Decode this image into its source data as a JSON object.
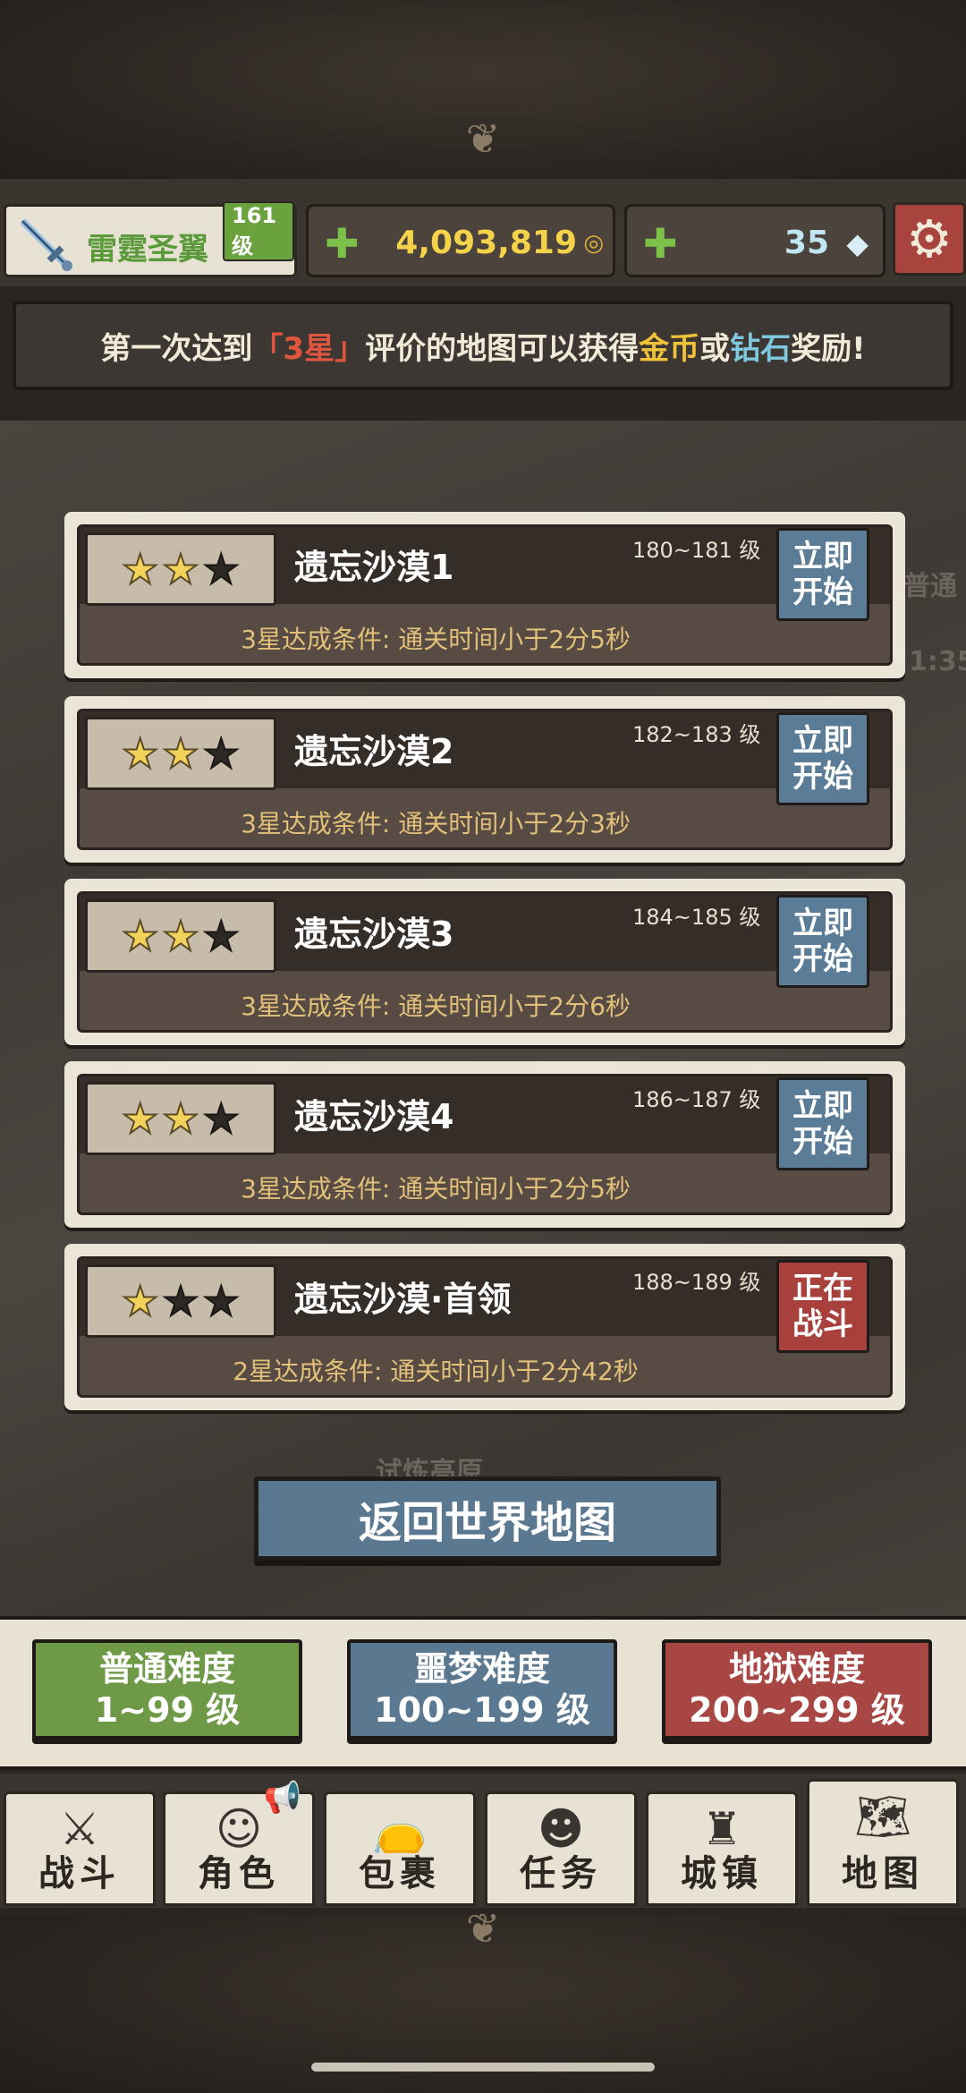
{
  "player": {
    "name": "雷霆圣翼",
    "level": "161 级"
  },
  "resources": {
    "gold": "4,093,819",
    "diamonds": "35"
  },
  "notice": {
    "part1": "第一次达到",
    "highlight_star": "「3星」",
    "part2": "评价的地图可以获得",
    "gold_word": "金币",
    "or_word": "或",
    "diamond_word": "钻石",
    "part3": "奖励!"
  },
  "levels": [
    {
      "name": "遗忘沙漠1",
      "range": "180~181 级",
      "stars": 2,
      "condition": "3星达成条件:  通关时间小于2分5秒",
      "button": "立即开始",
      "status": "start"
    },
    {
      "name": "遗忘沙漠2",
      "range": "182~183 级",
      "stars": 2,
      "condition": "3星达成条件:  通关时间小于2分3秒",
      "button": "立即开始",
      "status": "start"
    },
    {
      "name": "遗忘沙漠3",
      "range": "184~185 级",
      "stars": 2,
      "condition": "3星达成条件:  通关时间小于2分6秒",
      "button": "立即开始",
      "status": "start"
    },
    {
      "name": "遗忘沙漠4",
      "range": "186~187 级",
      "stars": 2,
      "condition": "3星达成条件:  通关时间小于2分5秒",
      "button": "立即开始",
      "status": "start"
    },
    {
      "name": "遗忘沙漠·首领",
      "range": "188~189 级",
      "stars": 1,
      "condition": "2星达成条件:  通关时间小于2分42秒",
      "button": "正在战斗",
      "status": "fighting"
    }
  ],
  "return_button": "返回世界地图",
  "difficulty": [
    {
      "name": "普通难度",
      "range": "1~99 级"
    },
    {
      "name": "噩梦难度",
      "range": "100~199 级"
    },
    {
      "name": "地狱难度",
      "range": "200~299 级"
    }
  ],
  "tabs": [
    {
      "label": "战斗",
      "icon": "crossed-swords-icon"
    },
    {
      "label": "角色",
      "icon": "character-icon"
    },
    {
      "label": "包裹",
      "icon": "bag-icon"
    },
    {
      "label": "任务",
      "icon": "quest-icon"
    },
    {
      "label": "城镇",
      "icon": "castle-icon"
    },
    {
      "label": "地图",
      "icon": "map-icon"
    }
  ],
  "map_background_text": [
    "普通",
    "1:35",
    "试炼高原"
  ],
  "colors": {
    "gold": "#f4d24a",
    "normal": "#6e9a48",
    "nightmare": "#5b7891",
    "hell": "#a84644",
    "fighting": "#a8403c"
  }
}
